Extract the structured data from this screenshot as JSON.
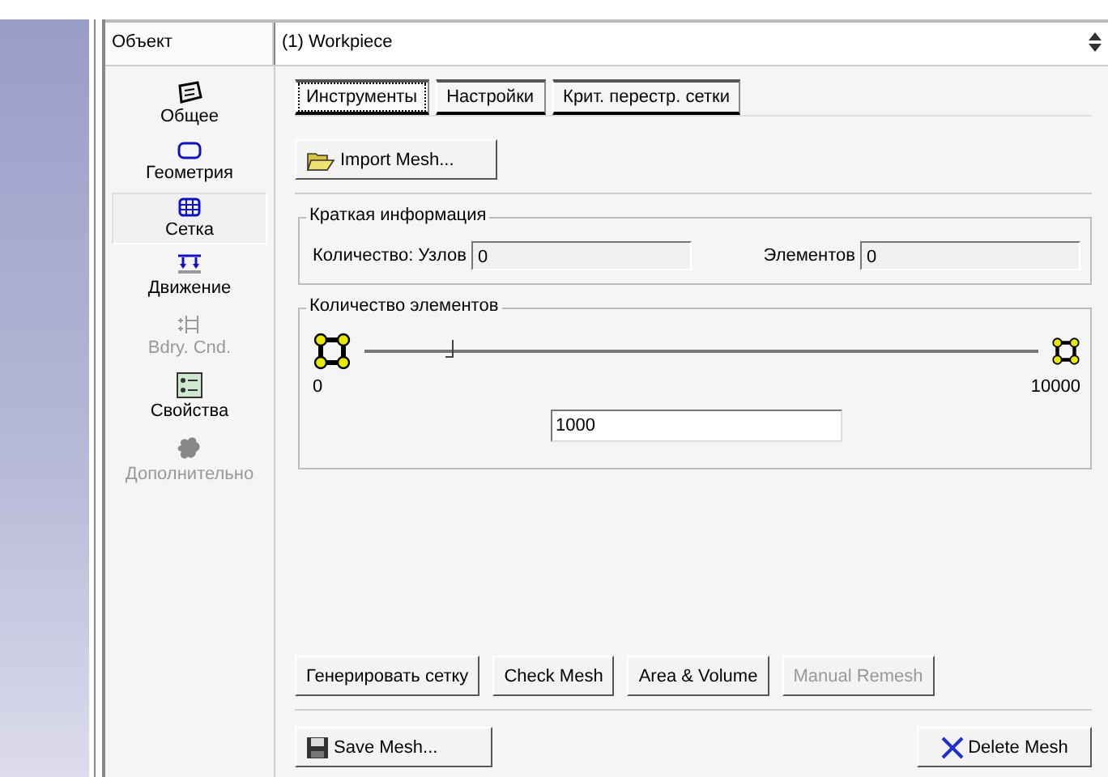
{
  "object_field": {
    "label": "Объект",
    "value": "(1) Workpiece"
  },
  "sidebar": {
    "items": [
      {
        "label": "Общее",
        "kind": "general",
        "selected": false,
        "disabled": false
      },
      {
        "label": "Геометрия",
        "kind": "geometry",
        "selected": false,
        "disabled": false
      },
      {
        "label": "Сетка",
        "kind": "mesh",
        "selected": true,
        "disabled": false
      },
      {
        "label": "Движение",
        "kind": "movement",
        "selected": false,
        "disabled": false
      },
      {
        "label": "Bdry. Cnd.",
        "kind": "boundary",
        "selected": false,
        "disabled": true
      },
      {
        "label": "Свойства",
        "kind": "properties",
        "selected": false,
        "disabled": false
      },
      {
        "label": "Дополнительно",
        "kind": "advanced",
        "selected": false,
        "disabled": true
      }
    ]
  },
  "tabs": [
    {
      "label": "Инструменты",
      "selected": true
    },
    {
      "label": "Настройки",
      "selected": false
    },
    {
      "label": "Крит. перестр. сетки",
      "selected": false
    }
  ],
  "import_button": "Import Mesh...",
  "summary": {
    "title": "Краткая информация",
    "nodes_label": "Количество: Узлов",
    "nodes_value": "0",
    "elements_label": "Элементов",
    "elements_value": "0"
  },
  "element_count": {
    "title": "Количество элементов",
    "level": 0.12,
    "min": "0",
    "max": "10000",
    "value": "1000"
  },
  "action_buttons": [
    {
      "label": "Генерировать сетку",
      "disabled": false
    },
    {
      "label": "Check Mesh",
      "disabled": false
    },
    {
      "label": "Area & Volume",
      "disabled": false
    },
    {
      "label": "Manual Remesh",
      "disabled": true
    }
  ],
  "save_button": "Save Mesh...",
  "delete_button": "Delete Mesh"
}
